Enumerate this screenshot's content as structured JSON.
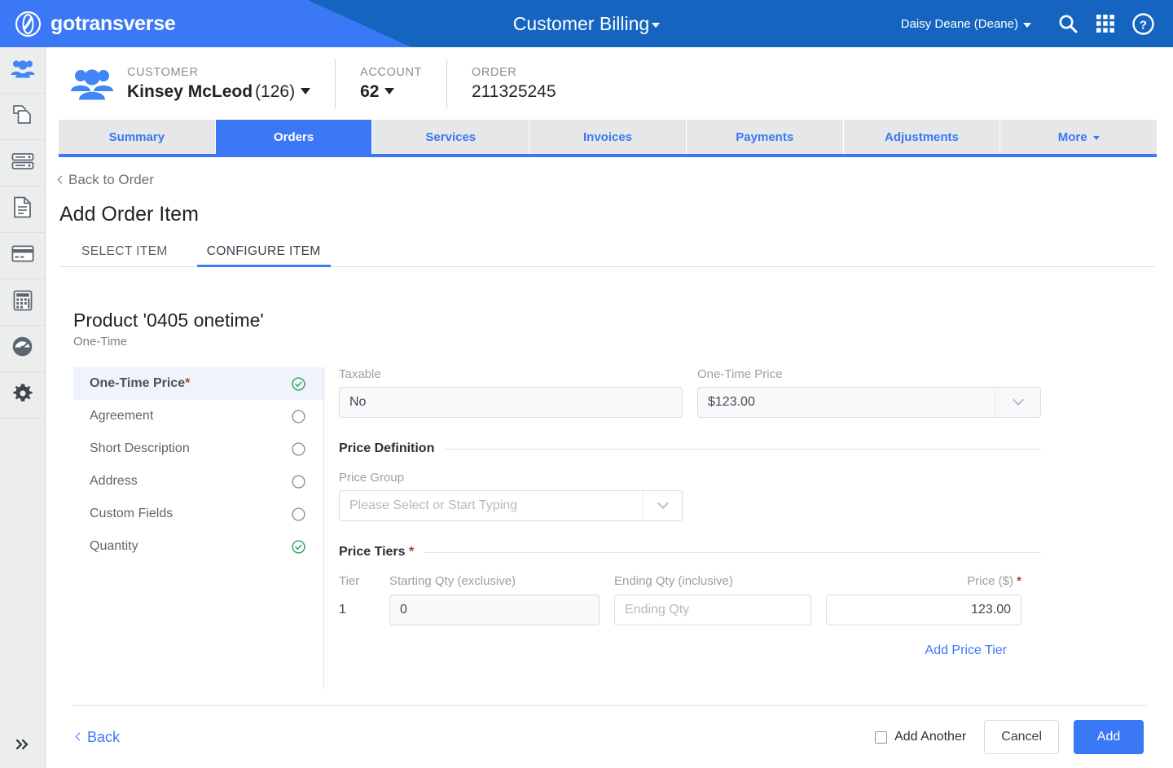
{
  "brand": {
    "name": "gotransverse",
    "logo_icon": "gotransverse-logo-icon"
  },
  "header": {
    "app_title": "Customer Billing",
    "user_name": "Daisy Deane (Deane)",
    "search_icon": "search-icon",
    "apps_icon": "apps-grid-icon",
    "help_icon": "help-circle-icon"
  },
  "sidebar": {
    "items": [
      {
        "icon": "customers-group-icon",
        "name": "customers"
      },
      {
        "icon": "products-copy-icon",
        "name": "products"
      },
      {
        "icon": "servers-stack-icon",
        "name": "servers"
      },
      {
        "icon": "document-icon",
        "name": "documents"
      },
      {
        "icon": "credit-card-icon",
        "name": "billing"
      },
      {
        "icon": "calculator-icon",
        "name": "calculator"
      },
      {
        "icon": "gauge-dashboard-icon",
        "name": "dashboard"
      },
      {
        "icon": "gear-icon",
        "name": "settings"
      }
    ],
    "expand_icon": "double-chevron-right-icon"
  },
  "context": {
    "avatar_icon": "customer-group-icon",
    "customer_label": "CUSTOMER",
    "customer_name": "Kinsey McLeod",
    "customer_id": "(126)",
    "account_label": "ACCOUNT",
    "account_value": "62",
    "order_label": "ORDER",
    "order_value": "211325245"
  },
  "nav_tabs": [
    {
      "label": "Summary",
      "active": false
    },
    {
      "label": "Orders",
      "active": true
    },
    {
      "label": "Services",
      "active": false
    },
    {
      "label": "Invoices",
      "active": false
    },
    {
      "label": "Payments",
      "active": false
    },
    {
      "label": "Adjustments",
      "active": false
    },
    {
      "label": "More",
      "active": false,
      "has_caret": true
    }
  ],
  "page": {
    "back_to_order": "Back to Order",
    "title": "Add Order Item",
    "subtabs": [
      {
        "label": "SELECT ITEM",
        "active": false
      },
      {
        "label": "CONFIGURE ITEM",
        "active": true
      }
    ]
  },
  "product": {
    "title": "Product '0405 onetime'",
    "subtitle": "One-Time"
  },
  "config_list": [
    {
      "label": "One-Time Price",
      "required": true,
      "status": "complete",
      "selected": true
    },
    {
      "label": "Agreement",
      "required": false,
      "status": "empty",
      "selected": false
    },
    {
      "label": "Short Description",
      "required": false,
      "status": "empty",
      "selected": false
    },
    {
      "label": "Address",
      "required": false,
      "status": "empty",
      "selected": false
    },
    {
      "label": "Custom Fields",
      "required": false,
      "status": "empty",
      "selected": false
    },
    {
      "label": "Quantity",
      "required": false,
      "status": "complete",
      "selected": false
    }
  ],
  "form": {
    "taxable_label": "Taxable",
    "taxable_value": "No",
    "onetime_price_label": "One-Time Price",
    "onetime_price_value": "$123.00",
    "price_definition_heading": "Price Definition",
    "price_group_label": "Price Group",
    "price_group_placeholder": "Please Select or Start Typing",
    "price_group_value": "",
    "price_tiers_heading": "Price Tiers",
    "price_tiers_required": "*",
    "tier_columns": {
      "tier": "Tier",
      "starting_qty": "Starting Qty (exclusive)",
      "ending_qty": "Ending Qty (inclusive)",
      "price": "Price ($)",
      "price_required": "*"
    },
    "tier_rows": [
      {
        "tier": "1",
        "starting_qty": "0",
        "ending_qty": "",
        "ending_qty_placeholder": "Ending Qty",
        "price": "123.00"
      }
    ],
    "add_price_tier": "Add Price Tier"
  },
  "footer": {
    "back": "Back",
    "add_another_label": "Add Another",
    "add_another_checked": false,
    "cancel_label": "Cancel",
    "add_label": "Add"
  },
  "colors": {
    "brand_blue": "#3b78f5",
    "header_dark_blue": "#1565c0",
    "green_check": "#2e9e57",
    "required_red": "#c0392b",
    "link_blue": "#3b78f5"
  }
}
